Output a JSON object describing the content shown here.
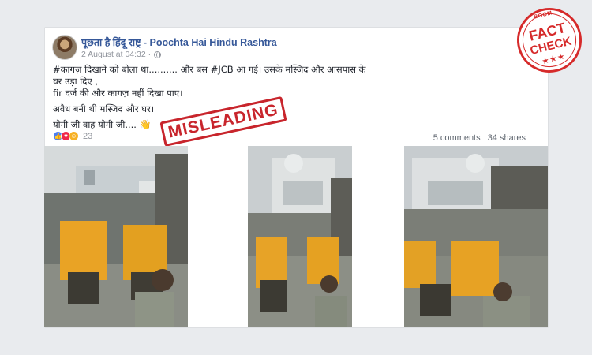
{
  "post": {
    "page_name": "पूछता है हिंदू राष्ट्र - Poochta Hai Hindu Rashtra",
    "timestamp": "2 August at 04:32 ·",
    "privacy_icon": "globe-icon",
    "text": {
      "line1": "#कागज़ दिखाने को बोला था.......... और बस #JCB आ गई। उसके मस्जिद और आसपास के",
      "line2": "घर उड़ा दिए ,",
      "line3": "fir दर्ज की और कागज़ नहीं दिखा पाए।",
      "line4": "अवैध बनी थी मस्जिद और घर।",
      "line5": "योगी जी वाह योगी जी....",
      "emoji": "👋"
    },
    "reactions": {
      "icons": [
        "like-icon",
        "love-icon",
        "haha-icon"
      ],
      "count": "23"
    },
    "comments": "5 comments",
    "shares": "34 shares"
  },
  "overlay": {
    "stamp_text": "MISLEADING",
    "badge": {
      "brand": "BOOM",
      "line1": "FACT",
      "line2": "CHECK",
      "stars": "★★★"
    }
  },
  "colors": {
    "link": "#365899",
    "stamp_red": "#c8252c",
    "background": "#e9ebee"
  }
}
